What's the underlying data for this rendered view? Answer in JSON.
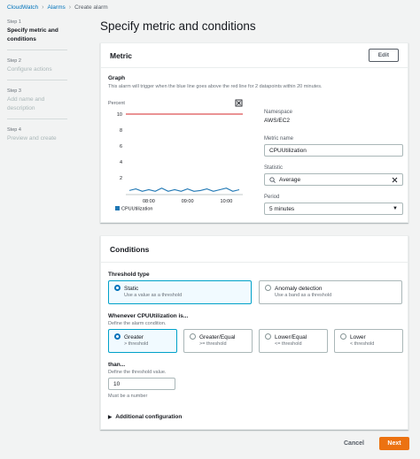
{
  "breadcrumb": {
    "items": [
      "CloudWatch",
      "Alarms",
      "Create alarm"
    ]
  },
  "steps": [
    {
      "number": "Step 1",
      "title": "Specify metric and conditions",
      "active": true
    },
    {
      "number": "Step 2",
      "title": "Configure actions",
      "active": false
    },
    {
      "number": "Step 3",
      "title": "Add name and description",
      "active": false
    },
    {
      "number": "Step 4",
      "title": "Preview and create",
      "active": false
    }
  ],
  "page_title": "Specify metric and conditions",
  "metric": {
    "title": "Metric",
    "edit_label": "Edit",
    "graph_label": "Graph",
    "graph_desc": "This alarm will trigger when the blue line goes above the red line for 2 datapoints within 20 minutes.",
    "y_label": "Percent",
    "y_ticks": [
      "10",
      "8",
      "6",
      "4",
      "2"
    ],
    "x_ticks": [
      "08:00",
      "09:00",
      "10:00"
    ],
    "legend": "CPUUtilization",
    "namespace_label": "Namespace",
    "namespace_value": "AWS/EC2",
    "metric_name_label": "Metric name",
    "metric_name_value": "CPUUtilization",
    "statistic_label": "Statistic",
    "statistic_value": "Average",
    "period_label": "Period",
    "period_value": "5 minutes"
  },
  "chart_data": {
    "type": "line",
    "ylabel": "Percent",
    "ylim": [
      0,
      10
    ],
    "x": [
      "07:30",
      "07:40",
      "07:50",
      "08:00",
      "08:10",
      "08:20",
      "08:30",
      "08:40",
      "08:50",
      "09:00",
      "09:10",
      "09:20",
      "09:30",
      "09:40",
      "09:50",
      "10:00",
      "10:10",
      "10:20"
    ],
    "series": [
      {
        "name": "CPUUtilization",
        "values": [
          0.4,
          0.6,
          0.3,
          0.5,
          0.3,
          0.7,
          0.3,
          0.5,
          0.3,
          0.6,
          0.3,
          0.4,
          0.6,
          0.3,
          0.5,
          0.7,
          0.3,
          0.5
        ],
        "color": "#1f77b4"
      }
    ],
    "threshold": 10,
    "threshold_color": "#d62728",
    "grid": false
  },
  "conditions": {
    "title": "Conditions",
    "threshold_type_label": "Threshold type",
    "static_title": "Static",
    "static_desc": "Use a value as a threshold",
    "anomaly_title": "Anomaly detection",
    "anomaly_desc": "Use a band as a threshold",
    "whenever_label": "Whenever CPUUtilization is...",
    "whenever_desc": "Define the alarm condition.",
    "options": [
      {
        "title": "Greater",
        "desc": "> threshold",
        "selected": true
      },
      {
        "title": "Greater/Equal",
        "desc": ">= threshold",
        "selected": false
      },
      {
        "title": "Lower/Equal",
        "desc": "<= threshold",
        "selected": false
      },
      {
        "title": "Lower",
        "desc": "< threshold",
        "selected": false
      }
    ],
    "than_label": "than...",
    "than_desc": "Define the threshold value.",
    "than_value": "10",
    "than_hint": "Must be a number",
    "additional_label": "Additional configuration"
  },
  "footer": {
    "cancel_label": "Cancel",
    "next_label": "Next"
  },
  "colors": {
    "accent": "#0073bb",
    "primary_button": "#ec7211",
    "selected_tile": "#00a1c9"
  }
}
